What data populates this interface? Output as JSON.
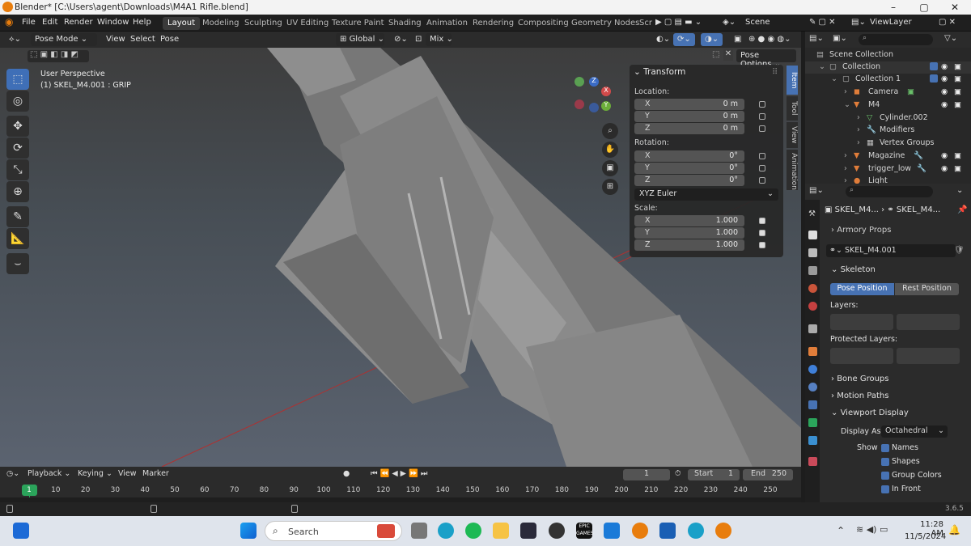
{
  "window": {
    "title": "Blender* [C:\\Users\\agent\\Downloads\\M4A1 Rifle.blend]"
  },
  "menu": [
    "File",
    "Edit",
    "Render",
    "Window",
    "Help"
  ],
  "workspaces": [
    "Layout",
    "Modeling",
    "Sculpting",
    "UV Editing",
    "Texture Paint",
    "Shading",
    "Animation",
    "Rendering",
    "Compositing",
    "Geometry Nodes",
    "Scr"
  ],
  "scene": {
    "name": "Scene",
    "view_layer": "ViewLayer"
  },
  "header3d": {
    "mode": "Pose Mode",
    "view": "View",
    "select": "Select",
    "pose": "Pose",
    "orientation": "Global",
    "mix": "Mix",
    "pose_options": "Pose Options"
  },
  "viewport": {
    "perspective": "User Perspective",
    "object_info": "(1) SKEL_M4.001 : GRIP"
  },
  "transform": {
    "title": "Transform",
    "location_label": "Location:",
    "location": [
      {
        "axis": "X",
        "value": "0 m"
      },
      {
        "axis": "Y",
        "value": "0 m"
      },
      {
        "axis": "Z",
        "value": "0 m"
      }
    ],
    "rotation_label": "Rotation:",
    "rotation": [
      {
        "axis": "X",
        "value": "0°"
      },
      {
        "axis": "Y",
        "value": "0°"
      },
      {
        "axis": "Z",
        "value": "0°"
      }
    ],
    "rotation_mode": "XYZ Euler",
    "scale_label": "Scale:",
    "scale": [
      {
        "axis": "X",
        "value": "1.000"
      },
      {
        "axis": "Y",
        "value": "1.000"
      },
      {
        "axis": "Z",
        "value": "1.000"
      }
    ]
  },
  "side_tabs": [
    "Item",
    "Tool",
    "View",
    "Animation"
  ],
  "outliner": {
    "rows": [
      {
        "label": "Scene Collection"
      },
      {
        "label": "Collection"
      },
      {
        "label": "Collection 1"
      },
      {
        "label": "Camera"
      },
      {
        "label": "M4"
      },
      {
        "label": "Cylinder.002"
      },
      {
        "label": "Modifiers"
      },
      {
        "label": "Vertex Groups"
      },
      {
        "label": "Magazine"
      },
      {
        "label": "trigger_low"
      },
      {
        "label": "Light"
      }
    ]
  },
  "properties": {
    "breadcrumb_a": "SKEL_M4...",
    "breadcrumb_b": "SKEL_M4...",
    "armory_props": "Armory Props",
    "data_name": "SKEL_M4.001",
    "skeleton": "Skeleton",
    "pose_position": "Pose Position",
    "rest_position": "Rest Position",
    "layers": "Layers:",
    "protected_layers": "Protected Layers:",
    "bone_groups": "Bone Groups",
    "motion_paths": "Motion Paths",
    "viewport_display": "Viewport Display",
    "display_as_label": "Display As",
    "display_as_value": "Octahedral",
    "show_label": "Show",
    "show_items": [
      "Names",
      "Shapes",
      "Group Colors",
      "In Front"
    ]
  },
  "timeline": {
    "playback": "Playback",
    "keying": "Keying",
    "view": "View",
    "marker": "Marker",
    "current_frame": "1",
    "start_label": "Start",
    "start": "1",
    "end_label": "End",
    "end": "250",
    "ticks": [
      "1",
      "10",
      "20",
      "30",
      "40",
      "50",
      "60",
      "70",
      "80",
      "90",
      "100",
      "110",
      "120",
      "130",
      "140",
      "150",
      "160",
      "170",
      "180",
      "190",
      "200",
      "210",
      "220",
      "230",
      "240",
      "250"
    ]
  },
  "status": {
    "version": "3.6.5"
  },
  "taskbar": {
    "search": "Search",
    "time": "11:28 AM",
    "date": "11/5/2024",
    "epic": "EPIC GAMES"
  },
  "colors": {
    "accent": "#4772b3",
    "blender_orange": "#e87d0d",
    "armature_green": "#2ba45b"
  }
}
